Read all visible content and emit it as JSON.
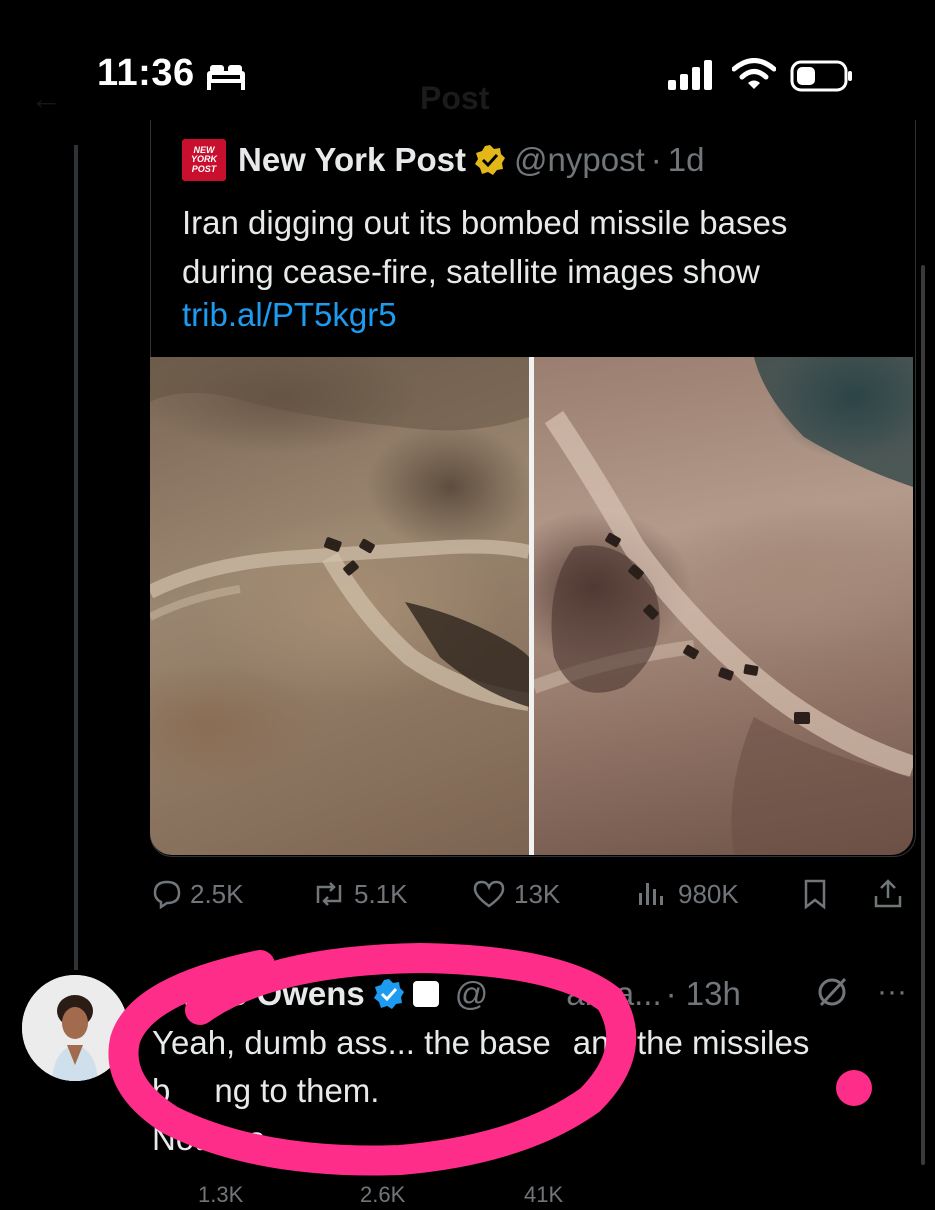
{
  "status_bar": {
    "time": "11:36",
    "icons": [
      "bed-icon",
      "signal-icon",
      "wifi-icon",
      "battery-icon"
    ]
  },
  "nav": {
    "ghost_title": "Post"
  },
  "quoted_post": {
    "logo_text": [
      "NEW",
      "YORK",
      "POST"
    ],
    "author_name": "New York Post",
    "handle": "@nypost",
    "separator": "·",
    "age": "1d",
    "text_line1": "Iran digging out its bombed missile bases",
    "text_line2": "during cease-fire, satellite images show",
    "link": "trib.al/PT5kgr5",
    "media": [
      "satellite-image-before",
      "satellite-image-after"
    ],
    "actions": {
      "replies": "2.5K",
      "reposts": "5.1K",
      "likes": "13K",
      "views": "980K"
    }
  },
  "reply_post": {
    "author_name": "ndace Owens",
    "handle": "@",
    "handle_tail": "alCa...",
    "age": "· 13h",
    "more": "···",
    "text_line1_a": "Yeah, dumb ass... the base",
    "text_line1_b": "and the missiles",
    "text_line2_a": "b",
    "text_line2_b": "ng to them.",
    "text_line3": "Not exa",
    "actions": {
      "replies": "1.3K",
      "reposts": "2.6K",
      "likes": "41K"
    }
  },
  "colors": {
    "accent": "#1d9bf0",
    "annotation": "#ff2d8a",
    "verified_gold": "#e2b719"
  }
}
